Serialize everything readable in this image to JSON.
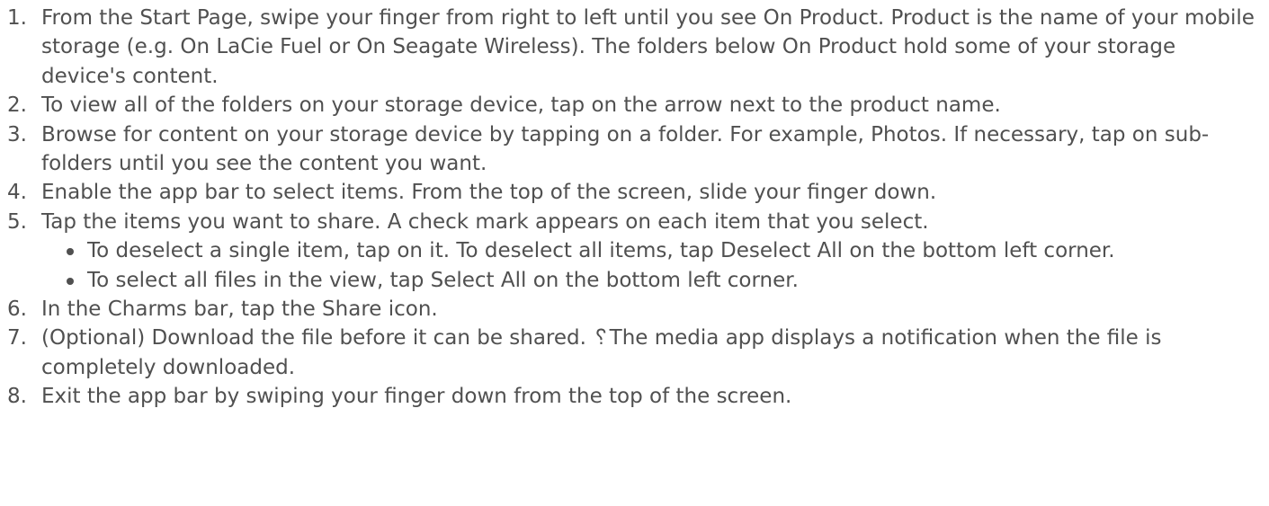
{
  "steps": [
    {
      "number": "1.",
      "text": "From the Start Page, swipe your finger from right to left until you see On Product. Product is the name of your mobile storage (e.g. On LaCie Fuel or On Seagate Wireless). The folders below On Product hold some of your storage device's content."
    },
    {
      "number": "2.",
      "text": "To view all of the folders on your storage device, tap on the arrow next to the product name."
    },
    {
      "number": "3.",
      "text": "Browse for content on your storage device by tapping on a folder. For example, Photos. If necessary, tap on sub-folders until you see the content you want."
    },
    {
      "number": "4.",
      "text": "Enable the app bar to select items. From the top of the screen, slide your finger down."
    },
    {
      "number": "5.",
      "text": "Tap the items you want to share. A check mark appears on each item that you select.",
      "bullets": [
        "To deselect a single item, tap on it. To deselect all items, tap Deselect All on the bottom left corner.",
        "To select all files in the view, tap Select All on the bottom left corner."
      ]
    },
    {
      "number": "6.",
      "text": "In the Charms bar, tap the Share icon."
    },
    {
      "number": "7.",
      "text": "(Optional) Download the file before it can be shared. ␦The media app displays a notification when the file is completely downloaded."
    },
    {
      "number": "8.",
      "text": "Exit the app bar by swiping your finger down from the top of the screen."
    }
  ],
  "colors": {
    "text": "#505050",
    "background": "#ffffff"
  }
}
